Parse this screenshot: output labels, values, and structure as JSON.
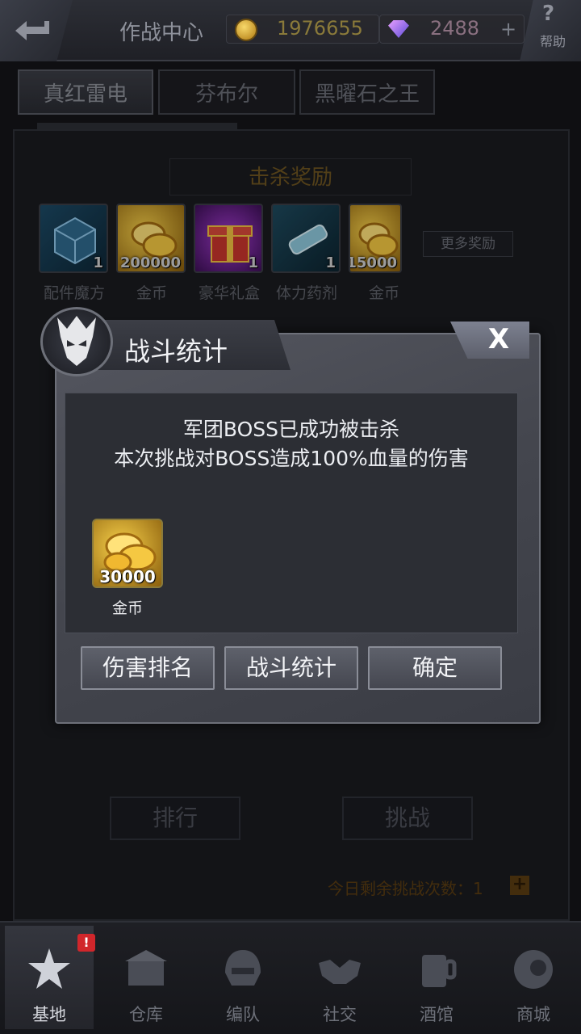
{
  "header": {
    "title": "作战中心",
    "gold": "1976655",
    "gems": "2488",
    "add": "+",
    "help_icon": "?",
    "help_label": "帮助"
  },
  "tabs": [
    {
      "label": "真红雷电",
      "active": true
    },
    {
      "label": "芬布尔",
      "active": false
    },
    {
      "label": "黑曜石之王",
      "active": false
    }
  ],
  "kill_reward": {
    "title": "击杀奖励",
    "items": [
      {
        "name": "配件魔方",
        "qty": "1",
        "icon": "accessory-cube-icon"
      },
      {
        "name": "金币",
        "qty": "200000",
        "icon": "gold-coins-icon"
      },
      {
        "name": "豪华礼盒",
        "qty": "1",
        "icon": "gift-box-icon"
      },
      {
        "name": "体力药剂",
        "qty": "1",
        "icon": "stamina-potion-icon"
      },
      {
        "name": "金币",
        "qty": "15000",
        "icon": "gold-coins-icon"
      }
    ],
    "more_button": "更多奖励"
  },
  "background_buttons": {
    "rank": "排行",
    "challenge": "挑战",
    "remaining_label": "今日剩余挑战次数：",
    "remaining_count": "1",
    "remaining_add": "+"
  },
  "dialog": {
    "title": "战斗统计",
    "close": "X",
    "message_line1": "军团BOSS已成功被击杀",
    "message_line2": "本次挑战对BOSS造成100%血量的伤害",
    "prize": {
      "name": "金币",
      "qty": "30000",
      "icon": "gold-coins-icon"
    },
    "buttons": {
      "damage_rank": "伤害排名",
      "battle_stats": "战斗统计",
      "confirm": "确定"
    }
  },
  "bottom_nav": [
    {
      "label": "基地",
      "icon": "base-star-icon",
      "active": true,
      "badge": "!"
    },
    {
      "label": "仓库",
      "icon": "warehouse-icon",
      "active": false
    },
    {
      "label": "编队",
      "icon": "helmet-icon",
      "active": false
    },
    {
      "label": "社交",
      "icon": "handshake-icon",
      "active": false
    },
    {
      "label": "酒馆",
      "icon": "mug-icon",
      "active": false
    },
    {
      "label": "商城",
      "icon": "shop-orb-icon",
      "active": false
    }
  ],
  "colors": {
    "accent_gold": "#6e5520",
    "badge_red": "#d1262b",
    "dialog_bg": "#4a4c54"
  }
}
